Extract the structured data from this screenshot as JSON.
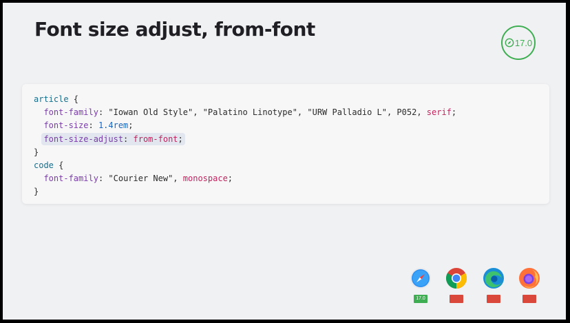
{
  "slide": {
    "title": "Font size adjust, from-font",
    "badge": {
      "icon": "compass-icon",
      "version": "17.0",
      "color": "#3fae52"
    }
  },
  "code": {
    "lines": [
      [
        {
          "t": "article",
          "c": "sel"
        },
        {
          "t": " {",
          "c": "punc"
        }
      ],
      [
        {
          "t": "  ",
          "c": "punc"
        },
        {
          "t": "font-family",
          "c": "prop"
        },
        {
          "t": ": ",
          "c": "punc"
        },
        {
          "t": "\"Iowan Old Style\", \"Palatino Linotype\", \"URW Palladio L\", P052, ",
          "c": "str"
        },
        {
          "t": "serif",
          "c": "kw"
        },
        {
          "t": ";",
          "c": "punc"
        }
      ],
      [
        {
          "t": "  ",
          "c": "punc"
        },
        {
          "t": "font-size",
          "c": "prop"
        },
        {
          "t": ": ",
          "c": "punc"
        },
        {
          "t": "1.4rem",
          "c": "num"
        },
        {
          "t": ";",
          "c": "punc"
        }
      ],
      [
        {
          "t": "  ",
          "c": "punc"
        },
        {
          "t": "font-size-adjust",
          "c": "prop hl-start"
        },
        {
          "t": ": ",
          "c": "punc hl-mid"
        },
        {
          "t": "from-font",
          "c": "kw hl-mid"
        },
        {
          "t": ";",
          "c": "punc hl-end"
        }
      ],
      [
        {
          "t": "}",
          "c": "punc"
        }
      ],
      [
        {
          "t": "code",
          "c": "sel"
        },
        {
          "t": " {",
          "c": "punc"
        }
      ],
      [
        {
          "t": "  ",
          "c": "punc"
        },
        {
          "t": "font-family",
          "c": "prop"
        },
        {
          "t": ": ",
          "c": "punc"
        },
        {
          "t": "\"Courier New\", ",
          "c": "str"
        },
        {
          "t": "monospace",
          "c": "kw"
        },
        {
          "t": ";",
          "c": "punc"
        }
      ],
      [
        {
          "t": "}",
          "c": "punc"
        }
      ]
    ],
    "highlight_line": 3,
    "colors": {
      "selector": "#1a6e8a",
      "property": "#7a3da8",
      "keyword": "#c0245e",
      "number": "#1565c0",
      "highlight": "#e1e6ef"
    }
  },
  "browsers": [
    {
      "name": "safari",
      "icon": "safari-icon",
      "supported": true,
      "label": "17.0"
    },
    {
      "name": "chrome",
      "icon": "chrome-icon",
      "supported": false,
      "label": ""
    },
    {
      "name": "edge",
      "icon": "edge-icon",
      "supported": false,
      "label": ""
    },
    {
      "name": "firefox",
      "icon": "firefox-icon",
      "supported": false,
      "label": ""
    }
  ]
}
